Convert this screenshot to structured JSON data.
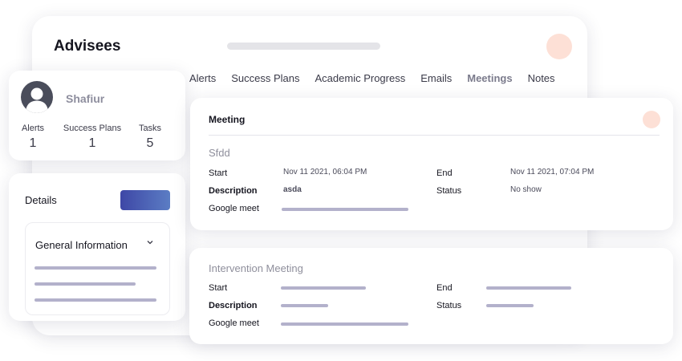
{
  "main": {
    "title": "Advisees",
    "tabs": [
      {
        "label": "Alerts"
      },
      {
        "label": "Success Plans"
      },
      {
        "label": "Academic Progress"
      },
      {
        "label": "Emails"
      },
      {
        "label": "Meetings",
        "active": true
      },
      {
        "label": "Notes"
      }
    ]
  },
  "profile": {
    "name": "Shafiur",
    "stats": [
      {
        "label": "Alerts",
        "value": "1"
      },
      {
        "label": "Success Plans",
        "value": "1"
      },
      {
        "label": "Tasks",
        "value": "5"
      }
    ]
  },
  "details": {
    "title": "Details",
    "section_label": "General Information"
  },
  "meeting": {
    "heading": "Meeting",
    "name": "Sfdd",
    "start_label": "Start",
    "start_value": "Nov 11 2021, 06:04 PM",
    "end_label": "End",
    "end_value": "Nov 11 2021, 07:04 PM",
    "description_label": "Description",
    "description_value": "asda",
    "status_label": "Status",
    "status_value": "No show",
    "google_meet_label": "Google meet"
  },
  "intervention": {
    "name": "Intervention Meeting",
    "start_label": "Start",
    "end_label": "End",
    "description_label": "Description",
    "status_label": "Status",
    "google_meet_label": "Google meet"
  },
  "colors": {
    "accent_peach": "#fde0d6",
    "button_gradient_start": "#3e47a6",
    "button_gradient_end": "#5b7dc4",
    "placeholder_bar": "#b3b1cb"
  }
}
